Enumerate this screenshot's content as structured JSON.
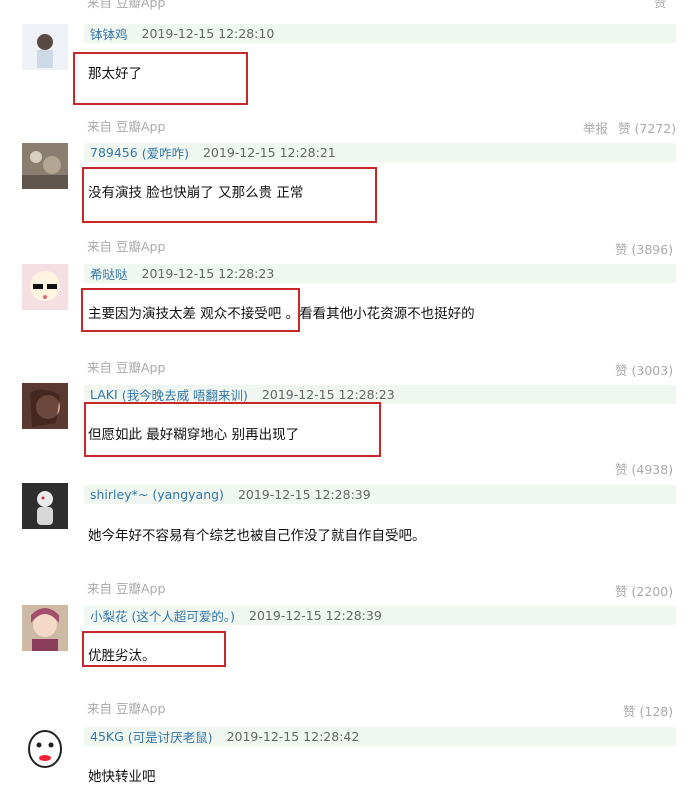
{
  "source_label": "来自 豆瓣App",
  "report_label": "举报",
  "like_label": "赞",
  "comments": [
    {
      "author": "钵钵鸡",
      "signature": "",
      "time": "2019-12-15 12:28:10",
      "content": "那太好了",
      "likes_text": "",
      "from": "来自 豆瓣App"
    },
    {
      "author": "789456",
      "signature": "(爱咋咋)",
      "time": "2019-12-15 12:28:21",
      "content": "没有演技 脸也快崩了 又那么贵 正常",
      "likes_text": "(7272)",
      "from": "来自 豆瓣App"
    },
    {
      "author": "希哒哒",
      "signature": "",
      "time": "2019-12-15 12:28:23",
      "content": "主要因为演技太差 观众不接受吧 。看看其他小花资源不也挺好的",
      "likes_text": "(3896)",
      "from": "来自 豆瓣App"
    },
    {
      "author": "LAKI",
      "signature": "(我今晚去威 唔翻来训)",
      "time": "2019-12-15 12:28:23",
      "content": "但愿如此 最好糊穿地心 别再出现了",
      "likes_text": "(3003)",
      "from": "来自 豆瓣App"
    },
    {
      "author": "shirley*~",
      "signature": "(yangyang)",
      "time": "2019-12-15 12:28:39",
      "content": "她今年好不容易有个综艺也被自己作没了就自作自受吧。",
      "likes_text": "(4938)",
      "from": ""
    },
    {
      "author": "小梨花",
      "signature": "(这个人超可爱的。)",
      "time": "2019-12-15 12:28:39",
      "content": "优胜劣汰。",
      "likes_text": "(2200)",
      "from": "来自 豆瓣App"
    },
    {
      "author": "45KG",
      "signature": "(可是讨厌老鼠)",
      "time": "2019-12-15 12:28:42",
      "content": "她快转业吧",
      "likes_text": "(128)",
      "from": "来自 豆瓣App"
    }
  ],
  "colors": {
    "author_link": "#3377aa",
    "author_bar_bg": "#f0f6f0",
    "meta_gray": "#aaaaaa",
    "highlight": "#c8272a"
  }
}
